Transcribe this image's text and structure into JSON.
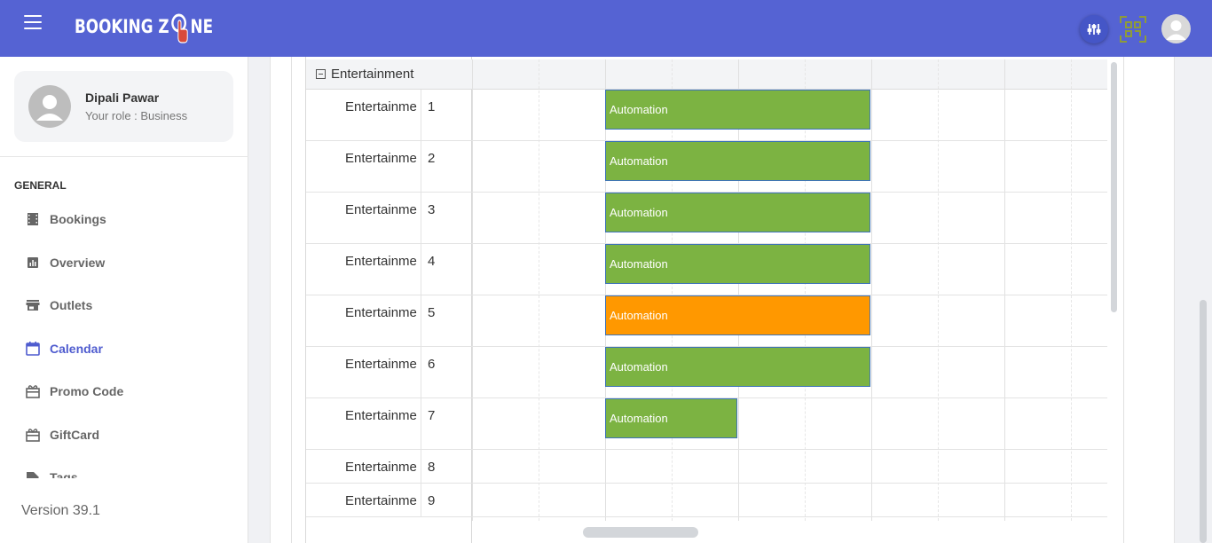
{
  "app": {
    "logo_text_pre": "BOOKING Z",
    "logo_text_post": "NE"
  },
  "header": {
    "icons": [
      "menu-icon",
      "filter-icon",
      "qr-code-icon",
      "user-avatar-icon"
    ]
  },
  "profile": {
    "name": "Dipali Pawar",
    "role": "Your role : Business"
  },
  "sidebar": {
    "section": "GENERAL",
    "items": [
      {
        "label": "Bookings",
        "icon": "bookings-icon",
        "active": false
      },
      {
        "label": "Overview",
        "icon": "overview-icon",
        "active": false
      },
      {
        "label": "Outlets",
        "icon": "store-icon",
        "active": false
      },
      {
        "label": "Calendar",
        "icon": "calendar-icon",
        "active": true
      },
      {
        "label": "Promo Code",
        "icon": "gift-icon",
        "active": false
      },
      {
        "label": "GiftCard",
        "icon": "giftcard-icon",
        "active": false
      },
      {
        "label": "Tags",
        "icon": "tag-icon",
        "active": false
      }
    ],
    "version": "Version 39.1"
  },
  "scheduler": {
    "group": "Entertainment",
    "resources": [
      {
        "name": "Entertainme",
        "number": "1",
        "event": {
          "label": "Automation",
          "status": "green"
        }
      },
      {
        "name": "Entertainme",
        "number": "2",
        "event": {
          "label": "Automation",
          "status": "green"
        }
      },
      {
        "name": "Entertainme",
        "number": "3",
        "event": {
          "label": "Automation",
          "status": "green"
        }
      },
      {
        "name": "Entertainme",
        "number": "4",
        "event": {
          "label": "Automation",
          "status": "green"
        }
      },
      {
        "name": "Entertainme",
        "number": "5",
        "event": {
          "label": "Automation",
          "status": "orange"
        }
      },
      {
        "name": "Entertainme",
        "number": "6",
        "event": {
          "label": "Automation",
          "status": "green"
        }
      },
      {
        "name": "Entertainme",
        "number": "7",
        "event": {
          "label": "Automation",
          "status": "green",
          "short": true
        }
      },
      {
        "name": "Entertainme",
        "number": "8",
        "event": null
      },
      {
        "name": "Entertainme",
        "number": "9",
        "event": null
      }
    ],
    "colors": {
      "green": "#7cb342",
      "orange": "#ff9800"
    }
  },
  "colors": {
    "primary": "#5563d3",
    "active_nav": "#4f5ccf"
  }
}
